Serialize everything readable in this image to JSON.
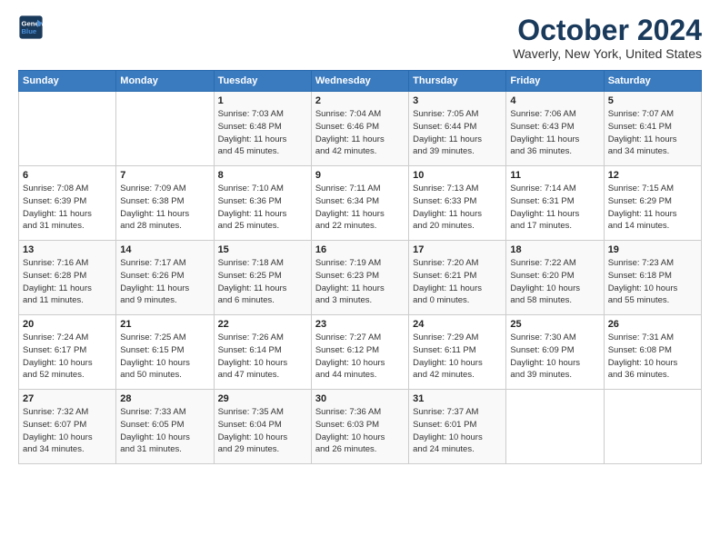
{
  "header": {
    "logo_line1": "General",
    "logo_line2": "Blue",
    "title": "October 2024",
    "location": "Waverly, New York, United States"
  },
  "days_of_week": [
    "Sunday",
    "Monday",
    "Tuesday",
    "Wednesday",
    "Thursday",
    "Friday",
    "Saturday"
  ],
  "weeks": [
    [
      {
        "day": "",
        "info": ""
      },
      {
        "day": "",
        "info": ""
      },
      {
        "day": "1",
        "info": "Sunrise: 7:03 AM\nSunset: 6:48 PM\nDaylight: 11 hours\nand 45 minutes."
      },
      {
        "day": "2",
        "info": "Sunrise: 7:04 AM\nSunset: 6:46 PM\nDaylight: 11 hours\nand 42 minutes."
      },
      {
        "day": "3",
        "info": "Sunrise: 7:05 AM\nSunset: 6:44 PM\nDaylight: 11 hours\nand 39 minutes."
      },
      {
        "day": "4",
        "info": "Sunrise: 7:06 AM\nSunset: 6:43 PM\nDaylight: 11 hours\nand 36 minutes."
      },
      {
        "day": "5",
        "info": "Sunrise: 7:07 AM\nSunset: 6:41 PM\nDaylight: 11 hours\nand 34 minutes."
      }
    ],
    [
      {
        "day": "6",
        "info": "Sunrise: 7:08 AM\nSunset: 6:39 PM\nDaylight: 11 hours\nand 31 minutes."
      },
      {
        "day": "7",
        "info": "Sunrise: 7:09 AM\nSunset: 6:38 PM\nDaylight: 11 hours\nand 28 minutes."
      },
      {
        "day": "8",
        "info": "Sunrise: 7:10 AM\nSunset: 6:36 PM\nDaylight: 11 hours\nand 25 minutes."
      },
      {
        "day": "9",
        "info": "Sunrise: 7:11 AM\nSunset: 6:34 PM\nDaylight: 11 hours\nand 22 minutes."
      },
      {
        "day": "10",
        "info": "Sunrise: 7:13 AM\nSunset: 6:33 PM\nDaylight: 11 hours\nand 20 minutes."
      },
      {
        "day": "11",
        "info": "Sunrise: 7:14 AM\nSunset: 6:31 PM\nDaylight: 11 hours\nand 17 minutes."
      },
      {
        "day": "12",
        "info": "Sunrise: 7:15 AM\nSunset: 6:29 PM\nDaylight: 11 hours\nand 14 minutes."
      }
    ],
    [
      {
        "day": "13",
        "info": "Sunrise: 7:16 AM\nSunset: 6:28 PM\nDaylight: 11 hours\nand 11 minutes."
      },
      {
        "day": "14",
        "info": "Sunrise: 7:17 AM\nSunset: 6:26 PM\nDaylight: 11 hours\nand 9 minutes."
      },
      {
        "day": "15",
        "info": "Sunrise: 7:18 AM\nSunset: 6:25 PM\nDaylight: 11 hours\nand 6 minutes."
      },
      {
        "day": "16",
        "info": "Sunrise: 7:19 AM\nSunset: 6:23 PM\nDaylight: 11 hours\nand 3 minutes."
      },
      {
        "day": "17",
        "info": "Sunrise: 7:20 AM\nSunset: 6:21 PM\nDaylight: 11 hours\nand 0 minutes."
      },
      {
        "day": "18",
        "info": "Sunrise: 7:22 AM\nSunset: 6:20 PM\nDaylight: 10 hours\nand 58 minutes."
      },
      {
        "day": "19",
        "info": "Sunrise: 7:23 AM\nSunset: 6:18 PM\nDaylight: 10 hours\nand 55 minutes."
      }
    ],
    [
      {
        "day": "20",
        "info": "Sunrise: 7:24 AM\nSunset: 6:17 PM\nDaylight: 10 hours\nand 52 minutes."
      },
      {
        "day": "21",
        "info": "Sunrise: 7:25 AM\nSunset: 6:15 PM\nDaylight: 10 hours\nand 50 minutes."
      },
      {
        "day": "22",
        "info": "Sunrise: 7:26 AM\nSunset: 6:14 PM\nDaylight: 10 hours\nand 47 minutes."
      },
      {
        "day": "23",
        "info": "Sunrise: 7:27 AM\nSunset: 6:12 PM\nDaylight: 10 hours\nand 44 minutes."
      },
      {
        "day": "24",
        "info": "Sunrise: 7:29 AM\nSunset: 6:11 PM\nDaylight: 10 hours\nand 42 minutes."
      },
      {
        "day": "25",
        "info": "Sunrise: 7:30 AM\nSunset: 6:09 PM\nDaylight: 10 hours\nand 39 minutes."
      },
      {
        "day": "26",
        "info": "Sunrise: 7:31 AM\nSunset: 6:08 PM\nDaylight: 10 hours\nand 36 minutes."
      }
    ],
    [
      {
        "day": "27",
        "info": "Sunrise: 7:32 AM\nSunset: 6:07 PM\nDaylight: 10 hours\nand 34 minutes."
      },
      {
        "day": "28",
        "info": "Sunrise: 7:33 AM\nSunset: 6:05 PM\nDaylight: 10 hours\nand 31 minutes."
      },
      {
        "day": "29",
        "info": "Sunrise: 7:35 AM\nSunset: 6:04 PM\nDaylight: 10 hours\nand 29 minutes."
      },
      {
        "day": "30",
        "info": "Sunrise: 7:36 AM\nSunset: 6:03 PM\nDaylight: 10 hours\nand 26 minutes."
      },
      {
        "day": "31",
        "info": "Sunrise: 7:37 AM\nSunset: 6:01 PM\nDaylight: 10 hours\nand 24 minutes."
      },
      {
        "day": "",
        "info": ""
      },
      {
        "day": "",
        "info": ""
      }
    ]
  ]
}
